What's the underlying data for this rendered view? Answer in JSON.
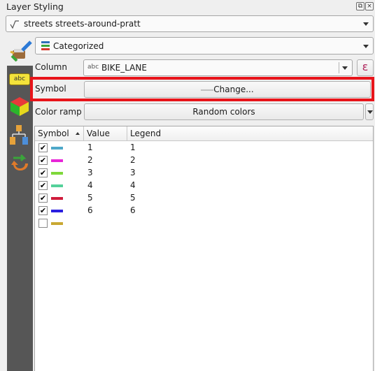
{
  "panel": {
    "title": "Layer Styling"
  },
  "layer_select": {
    "icon": "line-layer-icon",
    "value": "streets streets-around-pratt"
  },
  "renderer_select": {
    "icon": "categorized-renderer-icon",
    "value": "Categorized"
  },
  "sidebar": {
    "icons": [
      "labels-icon",
      "3d-view-icon",
      "diagrams-icon",
      "history-icon"
    ],
    "labels_badge": "abc"
  },
  "column": {
    "label": "Column",
    "type_badge": "abc",
    "value": "BIKE_LANE",
    "expression_glyph": "ε"
  },
  "symbol": {
    "label": "Symbol",
    "button": "Change..."
  },
  "color_ramp": {
    "label": "Color ramp",
    "value": "Random colors"
  },
  "table": {
    "headers": [
      "Symbol",
      "Value",
      "Legend"
    ],
    "rows": [
      {
        "checked": true,
        "color": "#4ea8c9",
        "value": "1",
        "legend": "1"
      },
      {
        "checked": true,
        "color": "#e826d8",
        "value": "2",
        "legend": "2"
      },
      {
        "checked": true,
        "color": "#7ed83a",
        "value": "3",
        "legend": "3"
      },
      {
        "checked": true,
        "color": "#55d19a",
        "value": "4",
        "legend": "4"
      },
      {
        "checked": true,
        "color": "#d01c3c",
        "value": "5",
        "legend": "5"
      },
      {
        "checked": true,
        "color": "#2b1fe0",
        "value": "6",
        "legend": "6"
      },
      {
        "checked": false,
        "color": "#c9a832",
        "value": "",
        "legend": ""
      }
    ]
  },
  "colors": {
    "highlight": "#e8141a",
    "sidebar": "#565656"
  }
}
